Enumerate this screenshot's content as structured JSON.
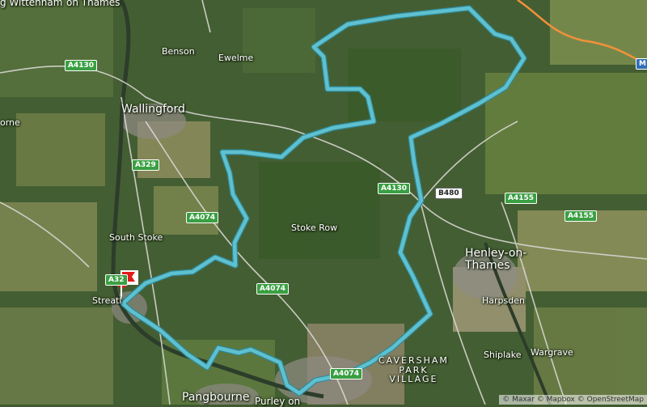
{
  "colors": {
    "route": "#5fc0cf",
    "route_outline": "#2f8b99",
    "marker": "#e11b1b",
    "motorway": "#f2913a"
  },
  "places": {
    "top_left": "g Wittenham",
    "top_left_2": "on Thames",
    "benson": "Benson",
    "ewelme": "Ewelme",
    "wallingford": "Wallingford",
    "borne": "orne",
    "south_stoke": "South Stoke",
    "streatley": "Streatl",
    "stoke_row": "Stoke Row",
    "henley": "Henley-on-\nThames",
    "harpsden": "Harpsden",
    "shiplake": "Shiplake",
    "wargrave": "Wargrave",
    "pangbourne": "Pangbourne",
    "purley": "Purley on",
    "caversham": "CAVERSHAM\nPARK\nVILLAGE"
  },
  "roads": {
    "a4130_w": "A4130",
    "a329": "A329",
    "a4074_n": "A4074",
    "a4074_s": "A4074",
    "a4130_e": "A4130",
    "b480": "B480",
    "a4155_a": "A4155",
    "a4155_b": "A4155",
    "a32": "A32",
    "a4074_bottom": "A4074",
    "m_edge": "M"
  },
  "attribution": "© Maxar © Mapbox © OpenStreetMap"
}
